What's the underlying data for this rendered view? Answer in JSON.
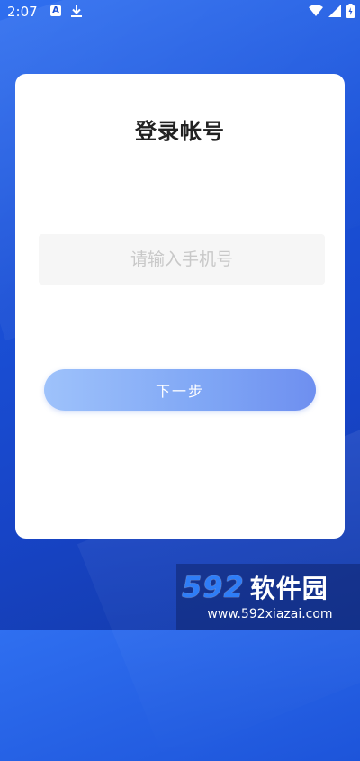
{
  "status_bar": {
    "time": "2:07",
    "notification_icons": [
      "a-app-icon",
      "download-icon"
    ],
    "system_icons": [
      "wifi-icon",
      "signal-icon",
      "battery-icon"
    ]
  },
  "login": {
    "title": "登录帐号",
    "phone_placeholder": "请输入手机号",
    "phone_value": "",
    "next_label": "下一步"
  },
  "watermark": {
    "logo_number": "592",
    "logo_text": "软件园",
    "url": "www.592xiazai.com"
  },
  "colors": {
    "background": "#1a50d6",
    "card": "#ffffff",
    "button_start": "#9ec2fb",
    "button_end": "#6e8ff0"
  }
}
